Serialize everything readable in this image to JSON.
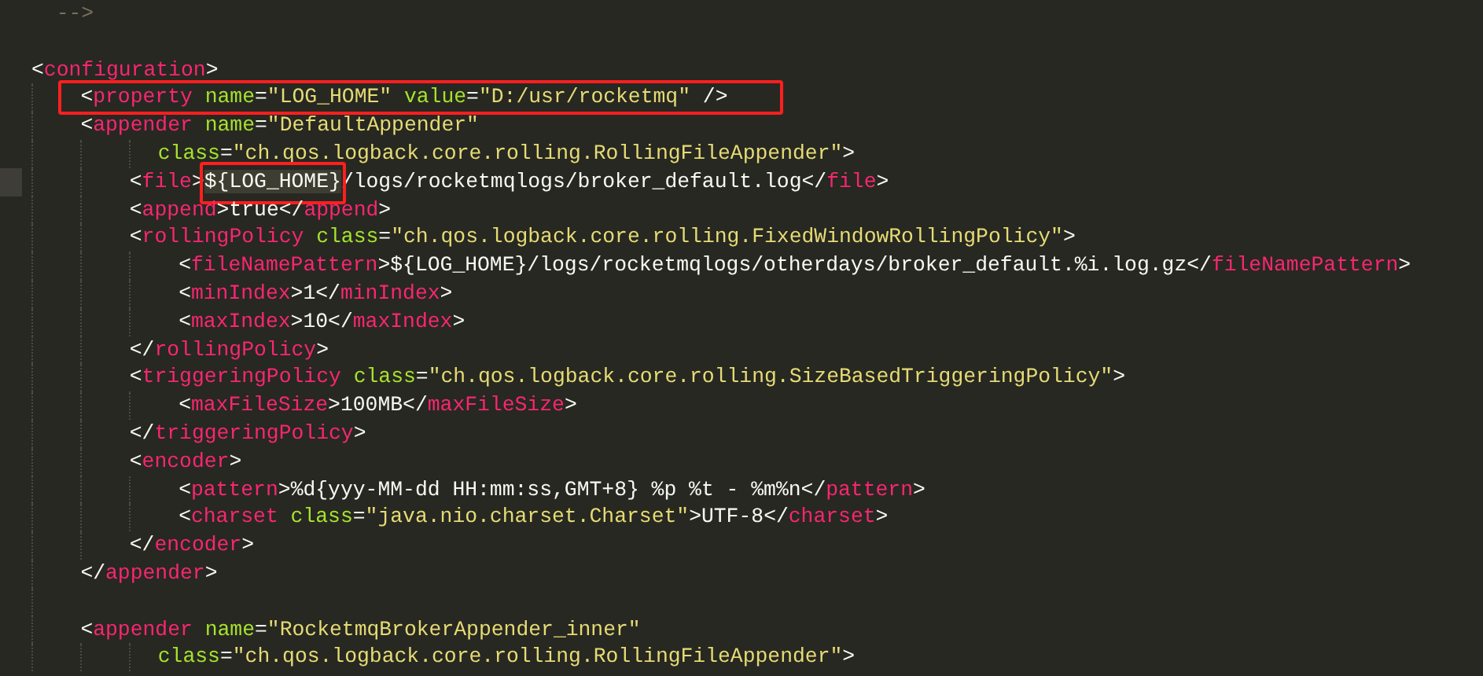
{
  "lines": [
    {
      "kind": "code",
      "boxed": false,
      "current": false,
      "tokens": [
        {
          "kind": "comment",
          "text": "  -->",
          "boxed": false
        }
      ]
    },
    {
      "kind": "blank",
      "boxed": false,
      "current": false
    },
    {
      "kind": "code",
      "boxed": false,
      "current": false,
      "tokens": [
        {
          "kind": "p",
          "text": "<",
          "boxed": false
        },
        {
          "kind": "tag",
          "text": "configuration",
          "boxed": false
        },
        {
          "kind": "p",
          "text": ">",
          "boxed": false
        }
      ],
      "children": [
        {
          "kind": "code",
          "boxed": true,
          "current": false,
          "tokens": [
            {
              "kind": "p",
              "text": "<",
              "boxed": false
            },
            {
              "kind": "tag",
              "text": "property",
              "boxed": false
            },
            {
              "kind": "attr",
              "text": " name",
              "boxed": false
            },
            {
              "kind": "p",
              "text": "=",
              "boxed": false
            },
            {
              "kind": "str",
              "text": "\"LOG_HOME\"",
              "boxed": false
            },
            {
              "kind": "attr",
              "text": " value",
              "boxed": false
            },
            {
              "kind": "p",
              "text": "=",
              "boxed": false
            },
            {
              "kind": "str",
              "text": "\"D:/usr/rocketmq\"",
              "boxed": false
            },
            {
              "kind": "p",
              "text": " />",
              "boxed": false
            }
          ]
        },
        {
          "kind": "code",
          "boxed": false,
          "current": false,
          "tokens": [
            {
              "kind": "p",
              "text": "<",
              "boxed": false
            },
            {
              "kind": "tag",
              "text": "appender",
              "boxed": false
            },
            {
              "kind": "attr",
              "text": " name",
              "boxed": false
            },
            {
              "kind": "p",
              "text": "=",
              "boxed": false
            },
            {
              "kind": "str",
              "text": "\"DefaultAppender\"",
              "boxed": false
            }
          ],
          "children": [
            {
              "kind": "continuation",
              "boxed": false,
              "current": false,
              "tokens": [
                {
                  "kind": "attr",
                  "text": "class",
                  "boxed": false
                },
                {
                  "kind": "p",
                  "text": "=",
                  "boxed": false
                },
                {
                  "kind": "str",
                  "text": "\"ch.qos.logback.core.rolling.RollingFileAppender\"",
                  "boxed": false
                },
                {
                  "kind": "p",
                  "text": ">",
                  "boxed": false
                }
              ]
            },
            {
              "kind": "code",
              "boxed": false,
              "current": true,
              "tokens": [
                {
                  "kind": "p",
                  "text": "<",
                  "boxed": false
                },
                {
                  "kind": "tag",
                  "text": "file",
                  "boxed": false
                },
                {
                  "kind": "p",
                  "text": ">",
                  "boxed": false
                },
                {
                  "kind": "text",
                  "text": "${LOG_HOME}",
                  "boxed": true
                },
                {
                  "kind": "text",
                  "text": "/logs/rocketmqlogs/broker_default.log",
                  "boxed": false
                },
                {
                  "kind": "p",
                  "text": "</",
                  "boxed": false
                },
                {
                  "kind": "tag",
                  "text": "file",
                  "boxed": false
                },
                {
                  "kind": "p",
                  "text": ">",
                  "boxed": false
                }
              ]
            },
            {
              "kind": "code",
              "boxed": false,
              "current": false,
              "tokens": [
                {
                  "kind": "p",
                  "text": "<",
                  "boxed": false
                },
                {
                  "kind": "tag",
                  "text": "append",
                  "boxed": false
                },
                {
                  "kind": "p",
                  "text": ">",
                  "boxed": false
                },
                {
                  "kind": "text",
                  "text": "true",
                  "boxed": false
                },
                {
                  "kind": "p",
                  "text": "</",
                  "boxed": false
                },
                {
                  "kind": "tag",
                  "text": "append",
                  "boxed": false
                },
                {
                  "kind": "p",
                  "text": ">",
                  "boxed": false
                }
              ]
            },
            {
              "kind": "code",
              "boxed": false,
              "current": false,
              "tokens": [
                {
                  "kind": "p",
                  "text": "<",
                  "boxed": false
                },
                {
                  "kind": "tag",
                  "text": "rollingPolicy",
                  "boxed": false
                },
                {
                  "kind": "attr",
                  "text": " class",
                  "boxed": false
                },
                {
                  "kind": "p",
                  "text": "=",
                  "boxed": false
                },
                {
                  "kind": "str",
                  "text": "\"ch.qos.logback.core.rolling.FixedWindowRollingPolicy\"",
                  "boxed": false
                },
                {
                  "kind": "p",
                  "text": ">",
                  "boxed": false
                }
              ],
              "children": [
                {
                  "kind": "code",
                  "boxed": false,
                  "current": false,
                  "tokens": [
                    {
                      "kind": "p",
                      "text": "<",
                      "boxed": false
                    },
                    {
                      "kind": "tag",
                      "text": "fileNamePattern",
                      "boxed": false
                    },
                    {
                      "kind": "p",
                      "text": ">",
                      "boxed": false
                    },
                    {
                      "kind": "text",
                      "text": "${LOG_HOME}/logs/rocketmqlogs/otherdays/broker_default.%i.log.gz",
                      "boxed": false
                    },
                    {
                      "kind": "p",
                      "text": "</",
                      "boxed": false
                    },
                    {
                      "kind": "tag",
                      "text": "fileNamePattern",
                      "boxed": false
                    },
                    {
                      "kind": "p",
                      "text": ">",
                      "boxed": false
                    }
                  ]
                },
                {
                  "kind": "code",
                  "boxed": false,
                  "current": false,
                  "tokens": [
                    {
                      "kind": "p",
                      "text": "<",
                      "boxed": false
                    },
                    {
                      "kind": "tag",
                      "text": "minIndex",
                      "boxed": false
                    },
                    {
                      "kind": "p",
                      "text": ">",
                      "boxed": false
                    },
                    {
                      "kind": "text",
                      "text": "1",
                      "boxed": false
                    },
                    {
                      "kind": "p",
                      "text": "</",
                      "boxed": false
                    },
                    {
                      "kind": "tag",
                      "text": "minIndex",
                      "boxed": false
                    },
                    {
                      "kind": "p",
                      "text": ">",
                      "boxed": false
                    }
                  ]
                },
                {
                  "kind": "code",
                  "boxed": false,
                  "current": false,
                  "tokens": [
                    {
                      "kind": "p",
                      "text": "<",
                      "boxed": false
                    },
                    {
                      "kind": "tag",
                      "text": "maxIndex",
                      "boxed": false
                    },
                    {
                      "kind": "p",
                      "text": ">",
                      "boxed": false
                    },
                    {
                      "kind": "text",
                      "text": "10",
                      "boxed": false
                    },
                    {
                      "kind": "p",
                      "text": "</",
                      "boxed": false
                    },
                    {
                      "kind": "tag",
                      "text": "maxIndex",
                      "boxed": false
                    },
                    {
                      "kind": "p",
                      "text": ">",
                      "boxed": false
                    }
                  ]
                }
              ]
            },
            {
              "kind": "code",
              "boxed": false,
              "current": false,
              "tokens": [
                {
                  "kind": "p",
                  "text": "</",
                  "boxed": false
                },
                {
                  "kind": "tag",
                  "text": "rollingPolicy",
                  "boxed": false
                },
                {
                  "kind": "p",
                  "text": ">",
                  "boxed": false
                }
              ]
            },
            {
              "kind": "code",
              "boxed": false,
              "current": false,
              "tokens": [
                {
                  "kind": "p",
                  "text": "<",
                  "boxed": false
                },
                {
                  "kind": "tag",
                  "text": "triggeringPolicy",
                  "boxed": false
                },
                {
                  "kind": "attr",
                  "text": " class",
                  "boxed": false
                },
                {
                  "kind": "p",
                  "text": "=",
                  "boxed": false
                },
                {
                  "kind": "str",
                  "text": "\"ch.qos.logback.core.rolling.SizeBasedTriggeringPolicy\"",
                  "boxed": false
                },
                {
                  "kind": "p",
                  "text": ">",
                  "boxed": false
                }
              ],
              "children": [
                {
                  "kind": "code",
                  "boxed": false,
                  "current": false,
                  "tokens": [
                    {
                      "kind": "p",
                      "text": "<",
                      "boxed": false
                    },
                    {
                      "kind": "tag",
                      "text": "maxFileSize",
                      "boxed": false
                    },
                    {
                      "kind": "p",
                      "text": ">",
                      "boxed": false
                    },
                    {
                      "kind": "text",
                      "text": "100MB",
                      "boxed": false
                    },
                    {
                      "kind": "p",
                      "text": "</",
                      "boxed": false
                    },
                    {
                      "kind": "tag",
                      "text": "maxFileSize",
                      "boxed": false
                    },
                    {
                      "kind": "p",
                      "text": ">",
                      "boxed": false
                    }
                  ]
                }
              ]
            },
            {
              "kind": "code",
              "boxed": false,
              "current": false,
              "tokens": [
                {
                  "kind": "p",
                  "text": "</",
                  "boxed": false
                },
                {
                  "kind": "tag",
                  "text": "triggeringPolicy",
                  "boxed": false
                },
                {
                  "kind": "p",
                  "text": ">",
                  "boxed": false
                }
              ]
            },
            {
              "kind": "code",
              "boxed": false,
              "current": false,
              "tokens": [
                {
                  "kind": "p",
                  "text": "<",
                  "boxed": false
                },
                {
                  "kind": "tag",
                  "text": "encoder",
                  "boxed": false
                },
                {
                  "kind": "p",
                  "text": ">",
                  "boxed": false
                }
              ],
              "children": [
                {
                  "kind": "code",
                  "boxed": false,
                  "current": false,
                  "tokens": [
                    {
                      "kind": "p",
                      "text": "<",
                      "boxed": false
                    },
                    {
                      "kind": "tag",
                      "text": "pattern",
                      "boxed": false
                    },
                    {
                      "kind": "p",
                      "text": ">",
                      "boxed": false
                    },
                    {
                      "kind": "text",
                      "text": "%d{yyy-MM-dd HH:mm:ss,GMT+8} %p %t - %m%n",
                      "boxed": false
                    },
                    {
                      "kind": "p",
                      "text": "</",
                      "boxed": false
                    },
                    {
                      "kind": "tag",
                      "text": "pattern",
                      "boxed": false
                    },
                    {
                      "kind": "p",
                      "text": ">",
                      "boxed": false
                    }
                  ]
                },
                {
                  "kind": "code",
                  "boxed": false,
                  "current": false,
                  "tokens": [
                    {
                      "kind": "p",
                      "text": "<",
                      "boxed": false
                    },
                    {
                      "kind": "tag",
                      "text": "charset",
                      "boxed": false
                    },
                    {
                      "kind": "attr",
                      "text": " class",
                      "boxed": false
                    },
                    {
                      "kind": "p",
                      "text": "=",
                      "boxed": false
                    },
                    {
                      "kind": "str",
                      "text": "\"java.nio.charset.Charset\"",
                      "boxed": false
                    },
                    {
                      "kind": "p",
                      "text": ">",
                      "boxed": false
                    },
                    {
                      "kind": "text",
                      "text": "UTF-8",
                      "boxed": false
                    },
                    {
                      "kind": "p",
                      "text": "</",
                      "boxed": false
                    },
                    {
                      "kind": "tag",
                      "text": "charset",
                      "boxed": false
                    },
                    {
                      "kind": "p",
                      "text": ">",
                      "boxed": false
                    }
                  ]
                }
              ]
            },
            {
              "kind": "code",
              "boxed": false,
              "current": false,
              "tokens": [
                {
                  "kind": "p",
                  "text": "</",
                  "boxed": false
                },
                {
                  "kind": "tag",
                  "text": "encoder",
                  "boxed": false
                },
                {
                  "kind": "p",
                  "text": ">",
                  "boxed": false
                }
              ]
            }
          ]
        },
        {
          "kind": "code",
          "boxed": false,
          "current": false,
          "tokens": [
            {
              "kind": "p",
              "text": "</",
              "boxed": false
            },
            {
              "kind": "tag",
              "text": "appender",
              "boxed": false
            },
            {
              "kind": "p",
              "text": ">",
              "boxed": false
            }
          ]
        },
        {
          "kind": "blank",
          "boxed": false,
          "current": false
        },
        {
          "kind": "code",
          "boxed": false,
          "current": false,
          "tokens": [
            {
              "kind": "p",
              "text": "<",
              "boxed": false
            },
            {
              "kind": "tag",
              "text": "appender",
              "boxed": false
            },
            {
              "kind": "attr",
              "text": " name",
              "boxed": false
            },
            {
              "kind": "p",
              "text": "=",
              "boxed": false
            },
            {
              "kind": "str",
              "text": "\"RocketmqBrokerAppender_inner\"",
              "boxed": false
            }
          ],
          "children": [
            {
              "kind": "continuation",
              "boxed": false,
              "current": false,
              "tokens": [
                {
                  "kind": "attr",
                  "text": "class",
                  "boxed": false
                },
                {
                  "kind": "p",
                  "text": "=",
                  "boxed": false
                },
                {
                  "kind": "str",
                  "text": "\"ch.qos.logback.core.rolling.RollingFileAppender\"",
                  "boxed": false
                },
                {
                  "kind": "p",
                  "text": ">",
                  "boxed": false
                }
              ]
            }
          ]
        }
      ]
    }
  ]
}
